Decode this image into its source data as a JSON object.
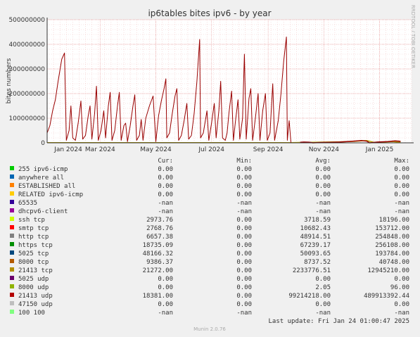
{
  "chart_data": {
    "type": "line",
    "title": "ip6tables bites ipv6 - by year",
    "ylabel": "bites numbers",
    "side_label": "RRDTOOL / TOBI OETIKER",
    "ylim": [
      0,
      500000000
    ],
    "y_ticks": [
      {
        "value": 0,
        "label": "0"
      },
      {
        "value": 100000000,
        "label": "100000000"
      },
      {
        "value": 200000000,
        "label": "200000000"
      },
      {
        "value": 300000000,
        "label": "300000000"
      },
      {
        "value": 400000000,
        "label": "400000000"
      },
      {
        "value": 500000000,
        "label": "500000000"
      }
    ],
    "x_range": [
      "2024-01-03",
      "2025-02-05"
    ],
    "x_ticks": [
      {
        "date": "2024-01-01",
        "label": "Jan 2024"
      },
      {
        "date": "2024-03-01",
        "label": "Mar 2024"
      },
      {
        "date": "2024-05-01",
        "label": "May 2024"
      },
      {
        "date": "2024-07-01",
        "label": "Jul 2024"
      },
      {
        "date": "2024-09-01",
        "label": "Sep 2024"
      },
      {
        "date": "2024-11-01",
        "label": "Nov 2024"
      },
      {
        "date": "2025-01-01",
        "label": "Jan 2025"
      }
    ],
    "series_main": {
      "name": "21413 udp",
      "color": "#990000",
      "points": [
        [
          "2024-01-03",
          40000000
        ],
        [
          "2024-01-06",
          70000000
        ],
        [
          "2024-01-09",
          130000000
        ],
        [
          "2024-01-12",
          175000000
        ],
        [
          "2024-01-15",
          250000000
        ],
        [
          "2024-01-19",
          340000000
        ],
        [
          "2024-01-22",
          365000000
        ],
        [
          "2024-01-24",
          10000000
        ],
        [
          "2024-01-27",
          50000000
        ],
        [
          "2024-01-29",
          150000000
        ],
        [
          "2024-01-31",
          20000000
        ],
        [
          "2024-02-03",
          10000000
        ],
        [
          "2024-02-06",
          80000000
        ],
        [
          "2024-02-09",
          170000000
        ],
        [
          "2024-02-11",
          15000000
        ],
        [
          "2024-02-14",
          30000000
        ],
        [
          "2024-02-17",
          110000000
        ],
        [
          "2024-02-19",
          150000000
        ],
        [
          "2024-02-21",
          15000000
        ],
        [
          "2024-02-24",
          120000000
        ],
        [
          "2024-02-26",
          230000000
        ],
        [
          "2024-02-28",
          10000000
        ],
        [
          "2024-03-02",
          50000000
        ],
        [
          "2024-03-05",
          130000000
        ],
        [
          "2024-03-07",
          20000000
        ],
        [
          "2024-03-10",
          150000000
        ],
        [
          "2024-03-12",
          205000000
        ],
        [
          "2024-03-14",
          10000000
        ],
        [
          "2024-03-17",
          50000000
        ],
        [
          "2024-03-20",
          150000000
        ],
        [
          "2024-03-22",
          205000000
        ],
        [
          "2024-03-24",
          10000000
        ],
        [
          "2024-03-27",
          70000000
        ],
        [
          "2024-03-29",
          80000000
        ],
        [
          "2024-03-31",
          5000000
        ],
        [
          "2024-04-03",
          70000000
        ],
        [
          "2024-04-06",
          150000000
        ],
        [
          "2024-04-08",
          195000000
        ],
        [
          "2024-04-10",
          10000000
        ],
        [
          "2024-04-13",
          30000000
        ],
        [
          "2024-04-15",
          95000000
        ],
        [
          "2024-04-17",
          10000000
        ],
        [
          "2024-04-20",
          100000000
        ],
        [
          "2024-04-24",
          150000000
        ],
        [
          "2024-04-28",
          190000000
        ],
        [
          "2024-05-01",
          5000000
        ],
        [
          "2024-05-04",
          110000000
        ],
        [
          "2024-05-07",
          170000000
        ],
        [
          "2024-05-10",
          220000000
        ],
        [
          "2024-05-12",
          260000000
        ],
        [
          "2024-05-13",
          20000000
        ],
        [
          "2024-05-16",
          40000000
        ],
        [
          "2024-05-19",
          120000000
        ],
        [
          "2024-05-22",
          190000000
        ],
        [
          "2024-05-24",
          220000000
        ],
        [
          "2024-05-26",
          10000000
        ],
        [
          "2024-05-29",
          30000000
        ],
        [
          "2024-06-01",
          90000000
        ],
        [
          "2024-06-04",
          160000000
        ],
        [
          "2024-06-06",
          15000000
        ],
        [
          "2024-06-09",
          30000000
        ],
        [
          "2024-06-12",
          120000000
        ],
        [
          "2024-06-15",
          250000000
        ],
        [
          "2024-06-18",
          420000000
        ],
        [
          "2024-06-19",
          20000000
        ],
        [
          "2024-06-22",
          40000000
        ],
        [
          "2024-06-26",
          130000000
        ],
        [
          "2024-06-28",
          10000000
        ],
        [
          "2024-07-01",
          80000000
        ],
        [
          "2024-07-04",
          160000000
        ],
        [
          "2024-07-06",
          20000000
        ],
        [
          "2024-07-09",
          130000000
        ],
        [
          "2024-07-11",
          250000000
        ],
        [
          "2024-07-13",
          20000000
        ],
        [
          "2024-07-16",
          10000000
        ],
        [
          "2024-07-18",
          40000000
        ],
        [
          "2024-07-20",
          120000000
        ],
        [
          "2024-07-23",
          210000000
        ],
        [
          "2024-07-25",
          10000000
        ],
        [
          "2024-07-27",
          80000000
        ],
        [
          "2024-07-30",
          175000000
        ],
        [
          "2024-08-01",
          15000000
        ],
        [
          "2024-08-04",
          100000000
        ],
        [
          "2024-08-06",
          360000000
        ],
        [
          "2024-08-08",
          15000000
        ],
        [
          "2024-08-11",
          180000000
        ],
        [
          "2024-08-13",
          220000000
        ],
        [
          "2024-08-15",
          10000000
        ],
        [
          "2024-08-18",
          100000000
        ],
        [
          "2024-08-21",
          200000000
        ],
        [
          "2024-08-23",
          10000000
        ],
        [
          "2024-08-26",
          130000000
        ],
        [
          "2024-08-29",
          200000000
        ],
        [
          "2024-08-31",
          10000000
        ],
        [
          "2024-09-03",
          40000000
        ],
        [
          "2024-09-06",
          240000000
        ],
        [
          "2024-09-08",
          10000000
        ],
        [
          "2024-09-12",
          90000000
        ],
        [
          "2024-09-15",
          200000000
        ],
        [
          "2024-09-18",
          330000000
        ],
        [
          "2024-09-21",
          430000000
        ],
        [
          "2024-09-22",
          10000000
        ],
        [
          "2024-09-24",
          90000000
        ],
        [
          "2024-09-26",
          0
        ]
      ]
    },
    "series_minor": {
      "name": "21413 tcp",
      "color": "#b8a000",
      "points": [
        [
          "2024-01-03",
          500000
        ],
        [
          "2024-01-20",
          800000
        ],
        [
          "2024-02-14",
          600000
        ],
        [
          "2024-03-10",
          700000
        ],
        [
          "2024-04-05",
          900000
        ],
        [
          "2024-05-01",
          800000
        ],
        [
          "2024-06-05",
          900000
        ],
        [
          "2024-07-01",
          1000000
        ],
        [
          "2024-08-01",
          900000
        ],
        [
          "2024-09-01",
          800000
        ],
        [
          "2024-09-26",
          500000
        ],
        [
          "2024-10-05",
          1500000
        ],
        [
          "2024-10-20",
          2000000
        ],
        [
          "2024-11-05",
          3000000
        ],
        [
          "2024-11-20",
          4000000
        ],
        [
          "2024-12-05",
          6000000
        ],
        [
          "2024-12-18",
          9000000
        ],
        [
          "2024-12-26",
          2000000
        ],
        [
          "2025-01-05",
          3000000
        ],
        [
          "2025-01-15",
          5000000
        ],
        [
          "2025-01-24",
          2000000
        ]
      ]
    },
    "late_segments": {
      "name": "21413 udp",
      "color": "#990000",
      "points": [
        [
          "2024-10-06",
          2000000
        ],
        [
          "2024-10-10",
          3000000
        ],
        [
          "2024-10-16",
          2500000
        ],
        [
          "2024-10-20",
          0
        ],
        [
          "2024-10-28",
          1500000
        ],
        [
          "2024-11-08",
          2000000
        ],
        [
          "2024-11-18",
          3000000
        ],
        [
          "2024-12-01",
          6000000
        ],
        [
          "2024-12-12",
          9000000
        ],
        [
          "2024-12-18",
          7000000
        ],
        [
          "2024-12-21",
          0
        ],
        [
          "2024-12-30",
          3000000
        ],
        [
          "2025-01-10",
          5000000
        ],
        [
          "2025-01-18",
          8000000
        ],
        [
          "2025-01-24",
          6000000
        ]
      ]
    }
  },
  "legend": {
    "headers": {
      "cur": "Cur:",
      "min": "Min:",
      "avg": "Avg:",
      "max": "Max:"
    },
    "rows": [
      {
        "color": "#00cc00",
        "name": "255 ipv6-icmp",
        "cur": "0.00",
        "min": "0.00",
        "avg": "0.00",
        "max": "0.00"
      },
      {
        "color": "#0066b3",
        "name": "anywhere all",
        "cur": "0.00",
        "min": "0.00",
        "avg": "0.00",
        "max": "0.00"
      },
      {
        "color": "#ff8000",
        "name": "ESTABLISHED all",
        "cur": "0.00",
        "min": "0.00",
        "avg": "0.00",
        "max": "0.00"
      },
      {
        "color": "#ffcc00",
        "name": "RELATED ipv6-icmp",
        "cur": "0.00",
        "min": "0.00",
        "avg": "0.00",
        "max": "0.00"
      },
      {
        "color": "#330099",
        "name": "65535",
        "cur": "-nan",
        "min": "-nan",
        "avg": "-nan",
        "max": "-nan"
      },
      {
        "color": "#990099",
        "name": "dhcpv6-client",
        "cur": "-nan",
        "min": "-nan",
        "avg": "-nan",
        "max": "-nan"
      },
      {
        "color": "#ccff00",
        "name": "ssh tcp",
        "cur": "2973.76",
        "min": "0.00",
        "avg": "3718.59",
        "max": "18196.00"
      },
      {
        "color": "#ff0000",
        "name": "smtp tcp",
        "cur": "2768.76",
        "min": "0.00",
        "avg": "10682.43",
        "max": "153712.00"
      },
      {
        "color": "#808080",
        "name": "http tcp",
        "cur": "6657.38",
        "min": "0.00",
        "avg": "48914.51",
        "max": "254848.00"
      },
      {
        "color": "#008f00",
        "name": "https tcp",
        "cur": "18735.09",
        "min": "0.00",
        "avg": "67239.17",
        "max": "256108.00"
      },
      {
        "color": "#00487d",
        "name": "5025 tcp",
        "cur": "48166.32",
        "min": "0.00",
        "avg": "50093.65",
        "max": "193784.00"
      },
      {
        "color": "#b35a00",
        "name": "8000 tcp",
        "cur": "9386.37",
        "min": "0.00",
        "avg": "8737.52",
        "max": "40748.00"
      },
      {
        "color": "#b38f00",
        "name": "21413 tcp",
        "cur": "21272.00",
        "min": "0.00",
        "avg": "2233776.51",
        "max": "12945210.00"
      },
      {
        "color": "#6b006b",
        "name": "5025 udp",
        "cur": "0.00",
        "min": "0.00",
        "avg": "0.00",
        "max": "0.00"
      },
      {
        "color": "#8fb300",
        "name": "8000 udp",
        "cur": "0.00",
        "min": "0.00",
        "avg": "2.05",
        "max": "96.00"
      },
      {
        "color": "#b30000",
        "name": "21413 udp",
        "cur": "18381.00",
        "min": "0.00",
        "avg": "99214218.00",
        "max": "489913392.44"
      },
      {
        "color": "#bebebe",
        "name": "47150 udp",
        "cur": "0.00",
        "min": "0.00",
        "avg": "0.00",
        "max": "0.00"
      },
      {
        "color": "#80ff80",
        "name": "100 100",
        "cur": "-nan",
        "min": "-nan",
        "avg": "-nan",
        "max": "-nan"
      }
    ]
  },
  "last_update": "Last update: Fri Jan 24 01:00:47 2025",
  "footer": "Munin 2.0.76"
}
